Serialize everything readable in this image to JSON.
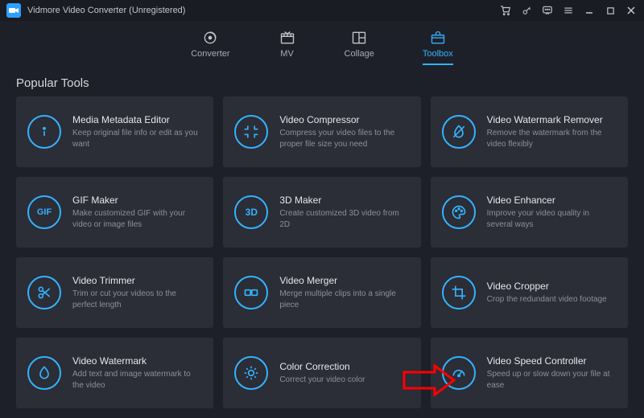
{
  "titlebar": {
    "title": "Vidmore Video Converter (Unregistered)"
  },
  "tabs": [
    {
      "id": "converter",
      "label": "Converter",
      "active": false
    },
    {
      "id": "mv",
      "label": "MV",
      "active": false
    },
    {
      "id": "collage",
      "label": "Collage",
      "active": false
    },
    {
      "id": "toolbox",
      "label": "Toolbox",
      "active": true
    }
  ],
  "section_title": "Popular Tools",
  "tools": [
    {
      "id": "media-metadata-editor",
      "title": "Media Metadata Editor",
      "desc": "Keep original file info or edit as you want"
    },
    {
      "id": "video-compressor",
      "title": "Video Compressor",
      "desc": "Compress your video files to the proper file size you need"
    },
    {
      "id": "video-watermark-remover",
      "title": "Video Watermark Remover",
      "desc": "Remove the watermark from the video flexibly"
    },
    {
      "id": "gif-maker",
      "title": "GIF Maker",
      "desc": "Make customized GIF with your video or image files",
      "text_icon": "GIF"
    },
    {
      "id": "3d-maker",
      "title": "3D Maker",
      "desc": "Create customized 3D video from 2D",
      "text_icon": "3D"
    },
    {
      "id": "video-enhancer",
      "title": "Video Enhancer",
      "desc": "Improve your video quality in several ways"
    },
    {
      "id": "video-trimmer",
      "title": "Video Trimmer",
      "desc": "Trim or cut your videos to the perfect length"
    },
    {
      "id": "video-merger",
      "title": "Video Merger",
      "desc": "Merge multiple clips into a single piece"
    },
    {
      "id": "video-cropper",
      "title": "Video Cropper",
      "desc": "Crop the redundant video footage"
    },
    {
      "id": "video-watermark",
      "title": "Video Watermark",
      "desc": "Add text and image watermark to the video"
    },
    {
      "id": "color-correction",
      "title": "Color Correction",
      "desc": "Correct your video color"
    },
    {
      "id": "video-speed-controller",
      "title": "Video Speed Controller",
      "desc": "Speed up or slow down your file at ease"
    }
  ],
  "colors": {
    "accent": "#33b3ff",
    "card": "#2b2d37",
    "bg": "#1e2029"
  }
}
